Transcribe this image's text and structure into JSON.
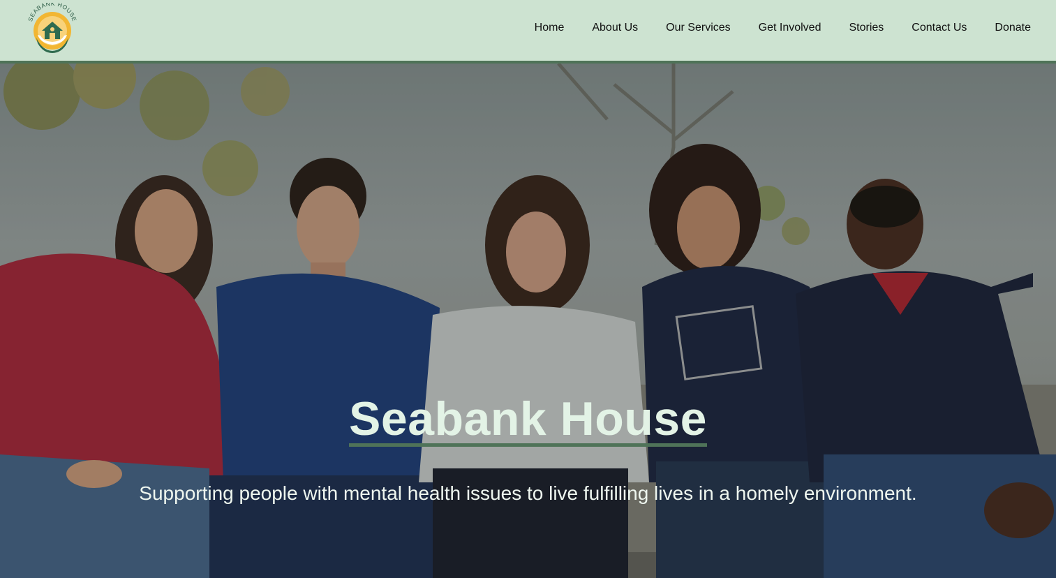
{
  "header": {
    "logo": {
      "icon": "house-hands-logo",
      "text": "SEABANK HOUSE"
    },
    "nav": [
      {
        "label": "Home"
      },
      {
        "label": "About Us"
      },
      {
        "label": "Our Services"
      },
      {
        "label": "Get Involved"
      },
      {
        "label": "Stories"
      },
      {
        "label": "Contact Us"
      },
      {
        "label": "Donate"
      }
    ]
  },
  "hero": {
    "title": "Seabank House",
    "subtitle": "Supporting people with mental health issues to live fulfilling lives in a homely environment.",
    "image": "group-of-five-smiling-young-people-photo"
  },
  "colors": {
    "header_bg": "#cde3d1",
    "accent": "#4f7358",
    "hero_text": "#e3f3e6"
  }
}
